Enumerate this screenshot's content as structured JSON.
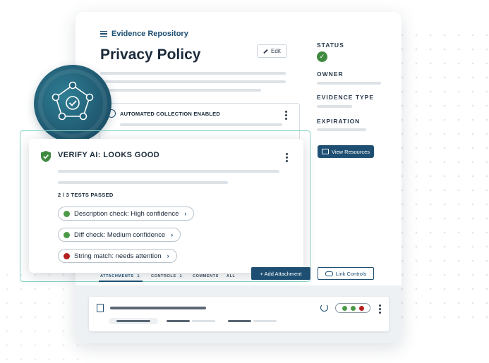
{
  "header": {
    "breadcrumb": "Evidence Repository",
    "title": "Privacy Policy",
    "edit_label": "Edit"
  },
  "sidebar": {
    "status_label": "STATUS",
    "owner_label": "OWNER",
    "evidence_type_label": "EVIDENCE TYPE",
    "expiration_label": "EXPIRATION",
    "view_resources_label": "View Resources"
  },
  "automated": {
    "label": "AUTOMATED COLLECTION ENABLED"
  },
  "verify": {
    "title": "VERIFY AI: LOOKS GOOD",
    "tests_passed": "2 / 3 TESTS PASSED",
    "checks": [
      {
        "label": "Description check: High confidence",
        "status_color": "#4c9a47"
      },
      {
        "label": "Diff check: Medium confidence",
        "status_color": "#4c9a47"
      },
      {
        "label": "String match: needs attention",
        "status_color": "#b51f1f"
      }
    ]
  },
  "tabs": [
    {
      "label": "ATTACHMENTS",
      "count": "1"
    },
    {
      "label": "CONTROLS",
      "count": "1"
    },
    {
      "label": "COMMENTS"
    },
    {
      "label": "ALL"
    }
  ],
  "actions": {
    "add_attachment": "+ Add Attachment",
    "link_controls": "Link Controls"
  },
  "row_status_colors": [
    "#4c9a47",
    "#4c9a47",
    "#b51f1f"
  ],
  "colors": {
    "brand": "#1e4f72",
    "success": "#3f8a3f",
    "danger": "#b51f1f",
    "highlight": "#89d3c8"
  }
}
